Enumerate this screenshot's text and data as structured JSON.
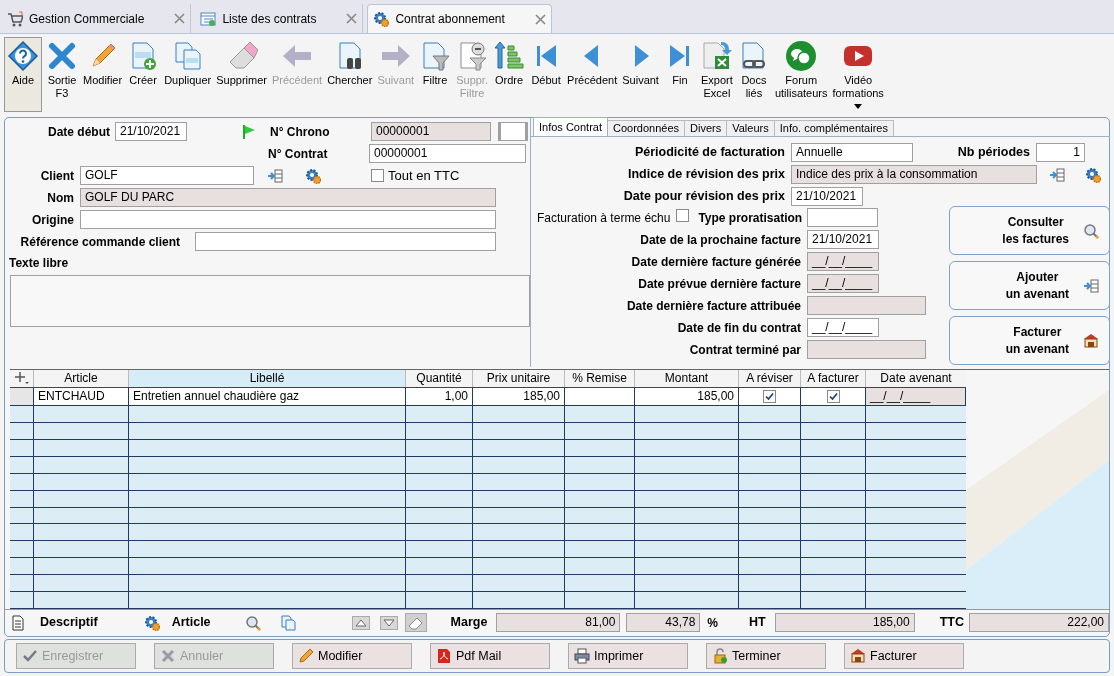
{
  "tabs": [
    {
      "label": "Gestion Commerciale",
      "selected": false
    },
    {
      "label": "Liste des contrats",
      "selected": false
    },
    {
      "label": "Contrat abonnement",
      "selected": true
    }
  ],
  "toolbar": [
    {
      "label": "Aide",
      "kind": "help",
      "selected": true,
      "disabled": false,
      "dropdown": false
    },
    {
      "label": "Sortie F3",
      "kind": "close",
      "selected": false,
      "disabled": false,
      "dropdown": false
    },
    {
      "label": "Modifier",
      "kind": "pencil",
      "selected": false,
      "disabled": false,
      "dropdown": false
    },
    {
      "label": "Créer",
      "kind": "docplus",
      "selected": false,
      "disabled": false,
      "dropdown": false
    },
    {
      "label": "Dupliquer",
      "kind": "docs",
      "selected": false,
      "disabled": false,
      "dropdown": false
    },
    {
      "label": "Supprimer",
      "kind": "eraser",
      "selected": false,
      "disabled": false,
      "dropdown": false
    },
    {
      "label": "Précédent",
      "kind": "arrowleft",
      "selected": false,
      "disabled": true,
      "dropdown": false
    },
    {
      "label": "Chercher",
      "kind": "binoc",
      "selected": false,
      "disabled": false,
      "dropdown": false
    },
    {
      "label": "Suivant",
      "kind": "arrowright",
      "selected": false,
      "disabled": true,
      "dropdown": false
    },
    {
      "label": "Filtre",
      "kind": "filter",
      "selected": false,
      "disabled": false,
      "dropdown": false
    },
    {
      "label": "Suppr. Filtre",
      "kind": "unfilter",
      "selected": false,
      "disabled": true,
      "dropdown": false
    },
    {
      "label": "Ordre",
      "kind": "sort",
      "selected": false,
      "disabled": false,
      "dropdown": false
    },
    {
      "label": "Début",
      "kind": "first",
      "selected": false,
      "disabled": false,
      "dropdown": false
    },
    {
      "label": "Précédent",
      "kind": "prev",
      "selected": false,
      "disabled": false,
      "dropdown": false
    },
    {
      "label": "Suivant",
      "kind": "next",
      "selected": false,
      "disabled": false,
      "dropdown": false
    },
    {
      "label": "Fin",
      "kind": "last",
      "selected": false,
      "disabled": false,
      "dropdown": false
    },
    {
      "label": "Export Excel",
      "kind": "excel",
      "selected": false,
      "disabled": false,
      "dropdown": false
    },
    {
      "label": "Docs liés",
      "kind": "linkdoc",
      "selected": false,
      "disabled": false,
      "dropdown": false
    },
    {
      "label": "Forum utilisateurs",
      "kind": "chat",
      "selected": false,
      "disabled": false,
      "dropdown": false
    },
    {
      "label": "Vidéo formations",
      "kind": "video",
      "selected": false,
      "disabled": false,
      "dropdown": true
    }
  ],
  "header": {
    "date_debut": {
      "label": "Date début",
      "value": "21/10/2021"
    },
    "chrono": {
      "label": "N° Chrono",
      "value": "00000001"
    },
    "contrat": {
      "label": "N° Contrat",
      "value": "00000001"
    },
    "client": {
      "label": "Client",
      "value": "GOLF"
    },
    "tout_ttc": {
      "label": "Tout en TTC",
      "checked": false
    },
    "nom": {
      "label": "Nom",
      "value": "GOLF DU PARC"
    },
    "origine": {
      "label": "Origine"
    },
    "reference": {
      "label": "Référence commande client"
    },
    "texte_libre": {
      "label": "Texte libre"
    }
  },
  "info_tabs": [
    {
      "label": "Infos Contrat",
      "selected": true
    },
    {
      "label": "Coordonnées",
      "selected": false
    },
    {
      "label": "Divers",
      "selected": false
    },
    {
      "label": "Valeurs",
      "selected": false
    },
    {
      "label": "Info. complémentaires",
      "selected": false
    }
  ],
  "infos": {
    "periodicite": {
      "label": "Périodicité de facturation",
      "value": "Annuelle"
    },
    "nb_periodes": {
      "label": "Nb périodes",
      "value": "1"
    },
    "indice": {
      "label": "Indice de révision des prix",
      "value": "Indice des prix à la consommation"
    },
    "date_revision": {
      "label": "Date pour révision des prix",
      "value": "21/10/2021"
    },
    "terme_echu": {
      "label": "Facturation à terme échu",
      "checked": false
    },
    "proratisation": {
      "label": "Type proratisation"
    },
    "dates": [
      {
        "label": "Date de la prochaine facture",
        "value": "21/10/2021",
        "kind": "date",
        "readonly": false
      },
      {
        "label": "Date dernière facture générée",
        "value": "__/__/____",
        "kind": "date",
        "readonly": true
      },
      {
        "label": "Date prévue dernière facture",
        "value": "__/__/____",
        "kind": "date",
        "readonly": true
      },
      {
        "label": "Date dernière facture attribuée",
        "kind": "text",
        "readonly": true
      },
      {
        "label": "Date de fin du contrat",
        "value": "__/__/____",
        "kind": "date",
        "readonly": false
      },
      {
        "label": "Contrat terminé par",
        "kind": "text",
        "readonly": true
      }
    ]
  },
  "actions": [
    {
      "lines": [
        "Consulter",
        "les factures"
      ]
    },
    {
      "lines": [
        "Ajouter",
        "un avenant"
      ]
    },
    {
      "lines": [
        "Facturer",
        "un avenant"
      ]
    }
  ],
  "grid": {
    "columns": [
      "Article",
      "Libellé",
      "Quantité",
      "Prix unitaire",
      "% Remise",
      "Montant",
      "A réviser",
      "A facturer",
      "Date avenant"
    ],
    "rows": [
      {
        "article": "ENTCHAUD",
        "libelle": "Entretien annuel chaudière gaz",
        "quantite": "1,00",
        "prix_unitaire": "185,00",
        "montant": "185,00",
        "a_reviser": true,
        "a_facturer": true,
        "date_avenant": "__/__/____"
      }
    ]
  },
  "footer": {
    "descriptif": "Descriptif",
    "article": "Article",
    "marge_label": "Marge",
    "marge": "81,00",
    "marge_pct": "43,78",
    "pct": "%",
    "ht_label": "HT",
    "ht": "185,00",
    "ttc_label": "TTC",
    "ttc": "222,00"
  },
  "buttons": [
    {
      "label": "Enregistrer",
      "disabled": true
    },
    {
      "label": "Annuler",
      "disabled": true
    },
    {
      "label": "Modifier",
      "disabled": false
    },
    {
      "label": "Pdf Mail",
      "disabled": false
    },
    {
      "label": "Imprimer",
      "disabled": false
    },
    {
      "label": "Terminer",
      "disabled": false
    },
    {
      "label": "Facturer",
      "disabled": false
    }
  ]
}
